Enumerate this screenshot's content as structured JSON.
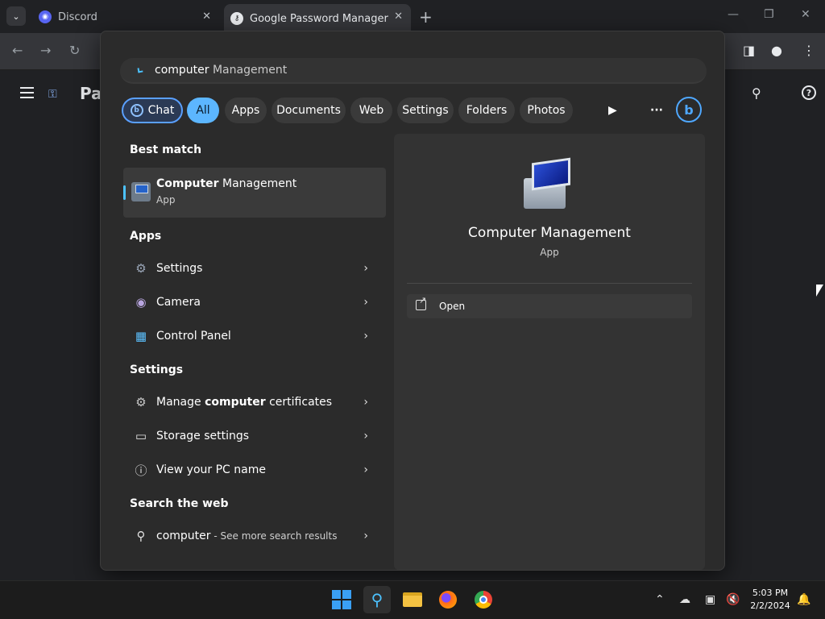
{
  "browser": {
    "tabs": [
      {
        "title": "Discord",
        "close": "✕"
      },
      {
        "title": "Google Password Manager",
        "close": "✕"
      }
    ],
    "new_tab": "+",
    "window_controls": {
      "minimize": "—",
      "restore": "❐",
      "close": "✕"
    }
  },
  "app": {
    "title_partial": "Pa"
  },
  "flyout": {
    "query_typed": "computer",
    "query_suggestion": " Management",
    "chips": [
      {
        "label": "Chat"
      },
      {
        "label": "All",
        "active": true
      },
      {
        "label": "Apps"
      },
      {
        "label": "Documents"
      },
      {
        "label": "Web"
      },
      {
        "label": "Settings"
      },
      {
        "label": "Folders"
      },
      {
        "label": "Photos"
      }
    ],
    "best_match": {
      "heading": "Best match",
      "name_bold": "Computer",
      "name_rest": " Management",
      "type": "App"
    },
    "apps": {
      "heading": "Apps",
      "items": [
        {
          "label": "Settings",
          "icon": "gear-icon"
        },
        {
          "label": "Camera",
          "icon": "camera-icon"
        },
        {
          "label": "Control Panel",
          "icon": "control-panel-icon"
        }
      ]
    },
    "settings": {
      "heading": "Settings",
      "items": [
        {
          "pre": "Manage ",
          "bold": "computer",
          "post": " certificates",
          "icon": "certificate-icon"
        },
        {
          "pre": "Storage settings",
          "bold": "",
          "post": "",
          "icon": "storage-icon"
        },
        {
          "pre": "View your PC name",
          "bold": "",
          "post": "",
          "icon": "info-icon"
        }
      ]
    },
    "web": {
      "heading": "Search the web",
      "query": "computer",
      "suffix": " - See more search results"
    },
    "preview": {
      "title": "Computer Management",
      "subtitle": "App",
      "open_label": "Open"
    }
  },
  "taskbar": {
    "time": "5:03 PM",
    "date": "2/2/2024"
  },
  "colors": {
    "accent": "#4cc2ff",
    "chip_active": "#5cb6ff",
    "flyout_bg": "#2b2b2b"
  }
}
